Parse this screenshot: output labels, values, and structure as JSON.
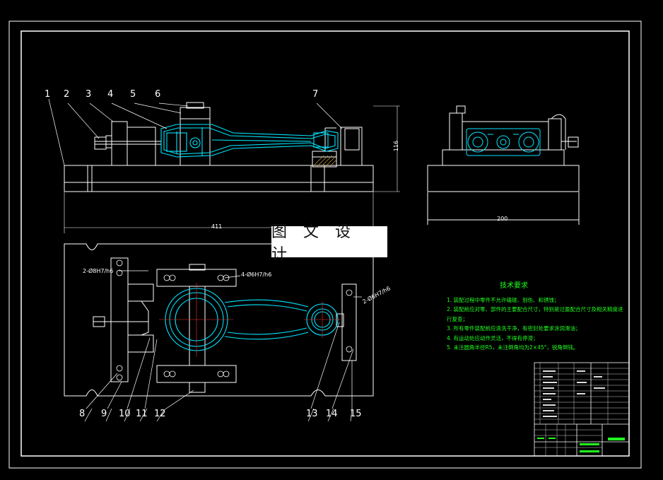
{
  "watermark": "图 文 设 计",
  "dimensions": {
    "length": "411",
    "height": "116",
    "width": "200",
    "hole_top_left": "2-Ø8H7/h6",
    "hole_top_mid": "4-Ø6H7/h6",
    "hole_right": "2-Ø6H7/h6"
  },
  "part_numbers": [
    "1",
    "2",
    "3",
    "4",
    "5",
    "6",
    "7",
    "8",
    "9",
    "10",
    "11",
    "12",
    "13",
    "14",
    "15"
  ],
  "technical_requirements": {
    "title": "技术要求",
    "items": [
      "1. 装配过程中零件不允许磕碰、划伤、和锈蚀；",
      "2. 装配前应对零、部件的主要配合尺寸，特别是过盈配合尺寸及相关精度进行复查；",
      "3. 所有零件装配前应清洗干净，有密封处要求涂润滑油；",
      "4. 有运动处应动作灵活，不得有停滞；",
      "5. 未注圆角半径R5，未注倒角均为2×45°，锐角倒钝。"
    ]
  },
  "colors": {
    "background": "#000000",
    "lines": "#ffffff",
    "part": "#00e5ff",
    "text_green": "#21ff21"
  }
}
